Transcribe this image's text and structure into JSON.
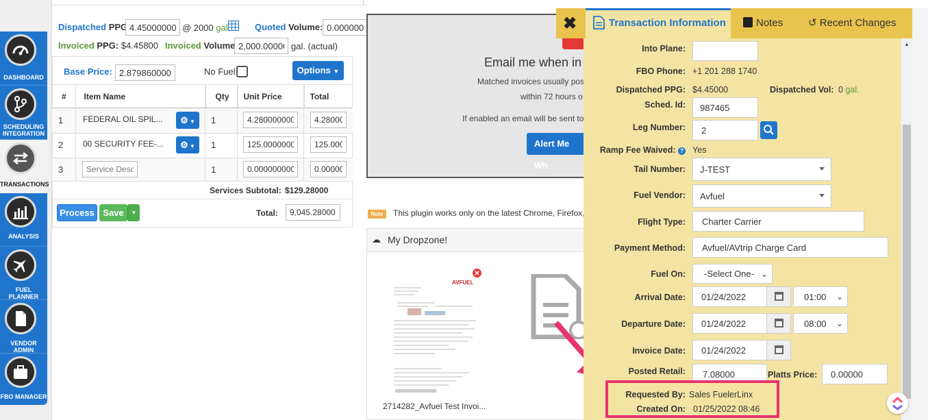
{
  "nav": [
    {
      "label": "DASHBOARD",
      "icon": "dashboard-icon"
    },
    {
      "label": "SCHEDULING INTEGRATION",
      "icon": "scheduling-icon"
    },
    {
      "label": "TRANSACTIONS",
      "icon": "transactions-icon"
    },
    {
      "label": "ANALYSIS",
      "icon": "analysis-icon"
    },
    {
      "label": "FUEL PLANNER",
      "icon": "fuel-planner-icon"
    },
    {
      "label": "VENDOR ADMIN",
      "icon": "vendor-admin-icon"
    },
    {
      "label": "FBO MANAGER",
      "icon": "fbo-manager-icon"
    }
  ],
  "summary": {
    "dispatched_word": "Dispatched",
    "ppg_word": "PPG:",
    "dispatched_ppg_value": "4.450000000",
    "at_text": "@ 2000",
    "gal_text": "gal.",
    "quoted_word": "Quoted",
    "volume_word": "Volume:",
    "quoted_volume_value": "0.00000000",
    "invoiced_word": "Invoiced",
    "invoiced_ppg_value": "$4.45800",
    "invoiced_volume_value": "2,000.000000",
    "gal_actual": "gal. (actual)"
  },
  "pricing": {
    "base_price_label": "Base Price:",
    "base_price_value": "2.8798600000",
    "no_fuel_label": "No Fuel",
    "options_label": "Options"
  },
  "items_table": {
    "headers": [
      "#",
      "Item Name",
      "Qty",
      "Unit Price",
      "Total"
    ],
    "rows": [
      {
        "num": "1",
        "name": "FEDERAL OIL SPIL...",
        "qty": "1",
        "unit": "4.280000000",
        "total": "4.28000"
      },
      {
        "num": "2",
        "name": "00 SECURITY FEE-...",
        "qty": "1",
        "unit": "125.0000000",
        "total": "125.000"
      },
      {
        "num": "3",
        "name": "",
        "placeholder": "Service Desc.",
        "qty": "1",
        "unit": "0.000000000",
        "total": "0.00000"
      }
    ],
    "subtotal_label": "Services Subtotal:",
    "subtotal_value": "$129.28000",
    "total_label": "Total:",
    "total_value": "9,045.28000"
  },
  "actions": {
    "process": "Process",
    "save": "Save"
  },
  "email_box": {
    "title": "Email me when in",
    "line1": "Matched invoices usually pos",
    "line2": "within 72 hours o",
    "line3": "If enabled an email will be sent to",
    "button": "Alert Me Wh"
  },
  "note": {
    "badge": "Note",
    "text": "This plugin works only on the latest Chrome, Firefox,"
  },
  "dropzone": {
    "title": "My Dropzone!",
    "file_name": "2714282_Avfuel Test Invoi..."
  },
  "tabs": {
    "info": "Transaction Information",
    "notes": "Notes",
    "changes": "Recent Changes"
  },
  "fields": {
    "into_plane_label": "Into Plane:",
    "into_plane_value": "",
    "fbo_phone_label": "FBO Phone:",
    "fbo_phone_value": "+1 201 288 1740",
    "dispatched_ppg_label": "Dispatched PPG:",
    "dispatched_ppg_value": "$4.45000",
    "dispatched_vol_label": "Dispatched Vol:",
    "dispatched_vol_value": "0",
    "dispatched_vol_unit": "gal.",
    "sched_label": "Sched. Id:",
    "sched_value": "987465",
    "leg_label": "Leg Number:",
    "leg_value": "2",
    "ramp_label": "Ramp Fee Waived:",
    "ramp_value": "Yes",
    "tail_label": "Tail Number:",
    "tail_value": "J-TEST",
    "vendor_label": "Fuel Vendor:",
    "vendor_value": "Avfuel",
    "flight_type_label": "Flight Type:",
    "flight_type_value": "Charter Carrier",
    "payment_label": "Payment Method:",
    "payment_value": "Avfuel/AVtrip Charge Card",
    "fuel_on_label": "Fuel On:",
    "fuel_on_value": "-Select One-",
    "arrival_label": "Arrival Date:",
    "arrival_date": "01/24/2022",
    "arrival_time": "01:00",
    "departure_label": "Departure Date:",
    "departure_date": "01/24/2022",
    "departure_time": "08:00",
    "invoice_label": "Invoice Date:",
    "invoice_date": "01/24/2022",
    "posted_label": "Posted Retail:",
    "posted_value": "7.08000",
    "platts_label": "Platts Price:",
    "platts_value": "0.00000",
    "requested_label": "Requested By:",
    "requested_value": "Sales FuelerLinx",
    "created_label": "Created On:",
    "created_value": "01/25/2022 08:46"
  },
  "colors": {
    "nav_blue": "#1f75cc",
    "panel_yellow": "#f4e4a3",
    "tab_gold": "#e8c34e",
    "highlight_pink": "#e8336d",
    "save_green": "#5cb85c"
  }
}
